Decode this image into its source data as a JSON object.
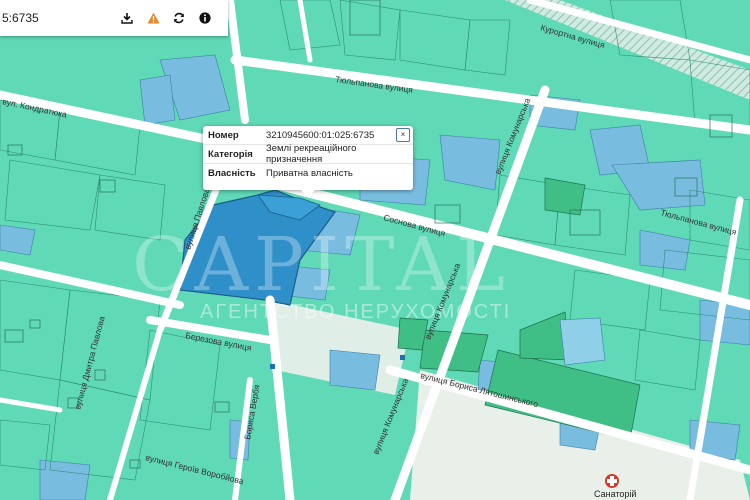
{
  "toolbar": {
    "cadastral_fragment": "5:6735",
    "buttons": [
      {
        "name": "download-button",
        "icon": "download-icon"
      },
      {
        "name": "warning-button",
        "icon": "warning-icon"
      },
      {
        "name": "refresh-button",
        "icon": "refresh-icon"
      },
      {
        "name": "info-button",
        "icon": "info-icon"
      }
    ]
  },
  "popup": {
    "close_label": "×",
    "rows": [
      {
        "key": "Номер",
        "value": "3210945600:01:025:6735"
      },
      {
        "key": "Категорія",
        "value": "Землі рекреаційного призначення"
      },
      {
        "key": "Власність",
        "value": "Приватна власність"
      }
    ]
  },
  "streets": {
    "kurortna": "Курортна вулиця",
    "tiulpanova_top": "Тюльпанова вулиця",
    "tiulpanova_right": "Тюльпанова вулиця",
    "sosnova": "Соснова вулиця",
    "berezova": "Березова вулиця",
    "kondratiuka": "вул. Кондратюка",
    "komunarska_1": "вулиця Комунарська",
    "komunarska_2": "вулиця Комунарська",
    "komunarska_3": "вулиця Комунарська",
    "liatoshynskoho": "вулиця Бориса Лятошинського",
    "dmytra_pavlova": "вулиця Дмитра Павлова",
    "heroiv_vorobiov": "вулиця Героїв Воробйова",
    "vertical_1": "вулиця Павлова",
    "vertical_2": "Бориса Вербя"
  },
  "watermark": {
    "logo": "CAPITAL",
    "subtitle": "АГЕНТСТВО НЕРУХОМОСТІ"
  },
  "poi": {
    "label": "Санаторій",
    "icon": "red-cross-icon"
  },
  "colors": {
    "background": "#5fd9b6",
    "parcel_green": "#6be0bf",
    "parcel_blue": "#78bde0",
    "selected_parcel": "#2e8fc9",
    "darkgreen_parcel": "#3fbf86",
    "road": "#ffffff",
    "accent_warning": "#e8882a",
    "poi_red": "#d23b2b"
  }
}
